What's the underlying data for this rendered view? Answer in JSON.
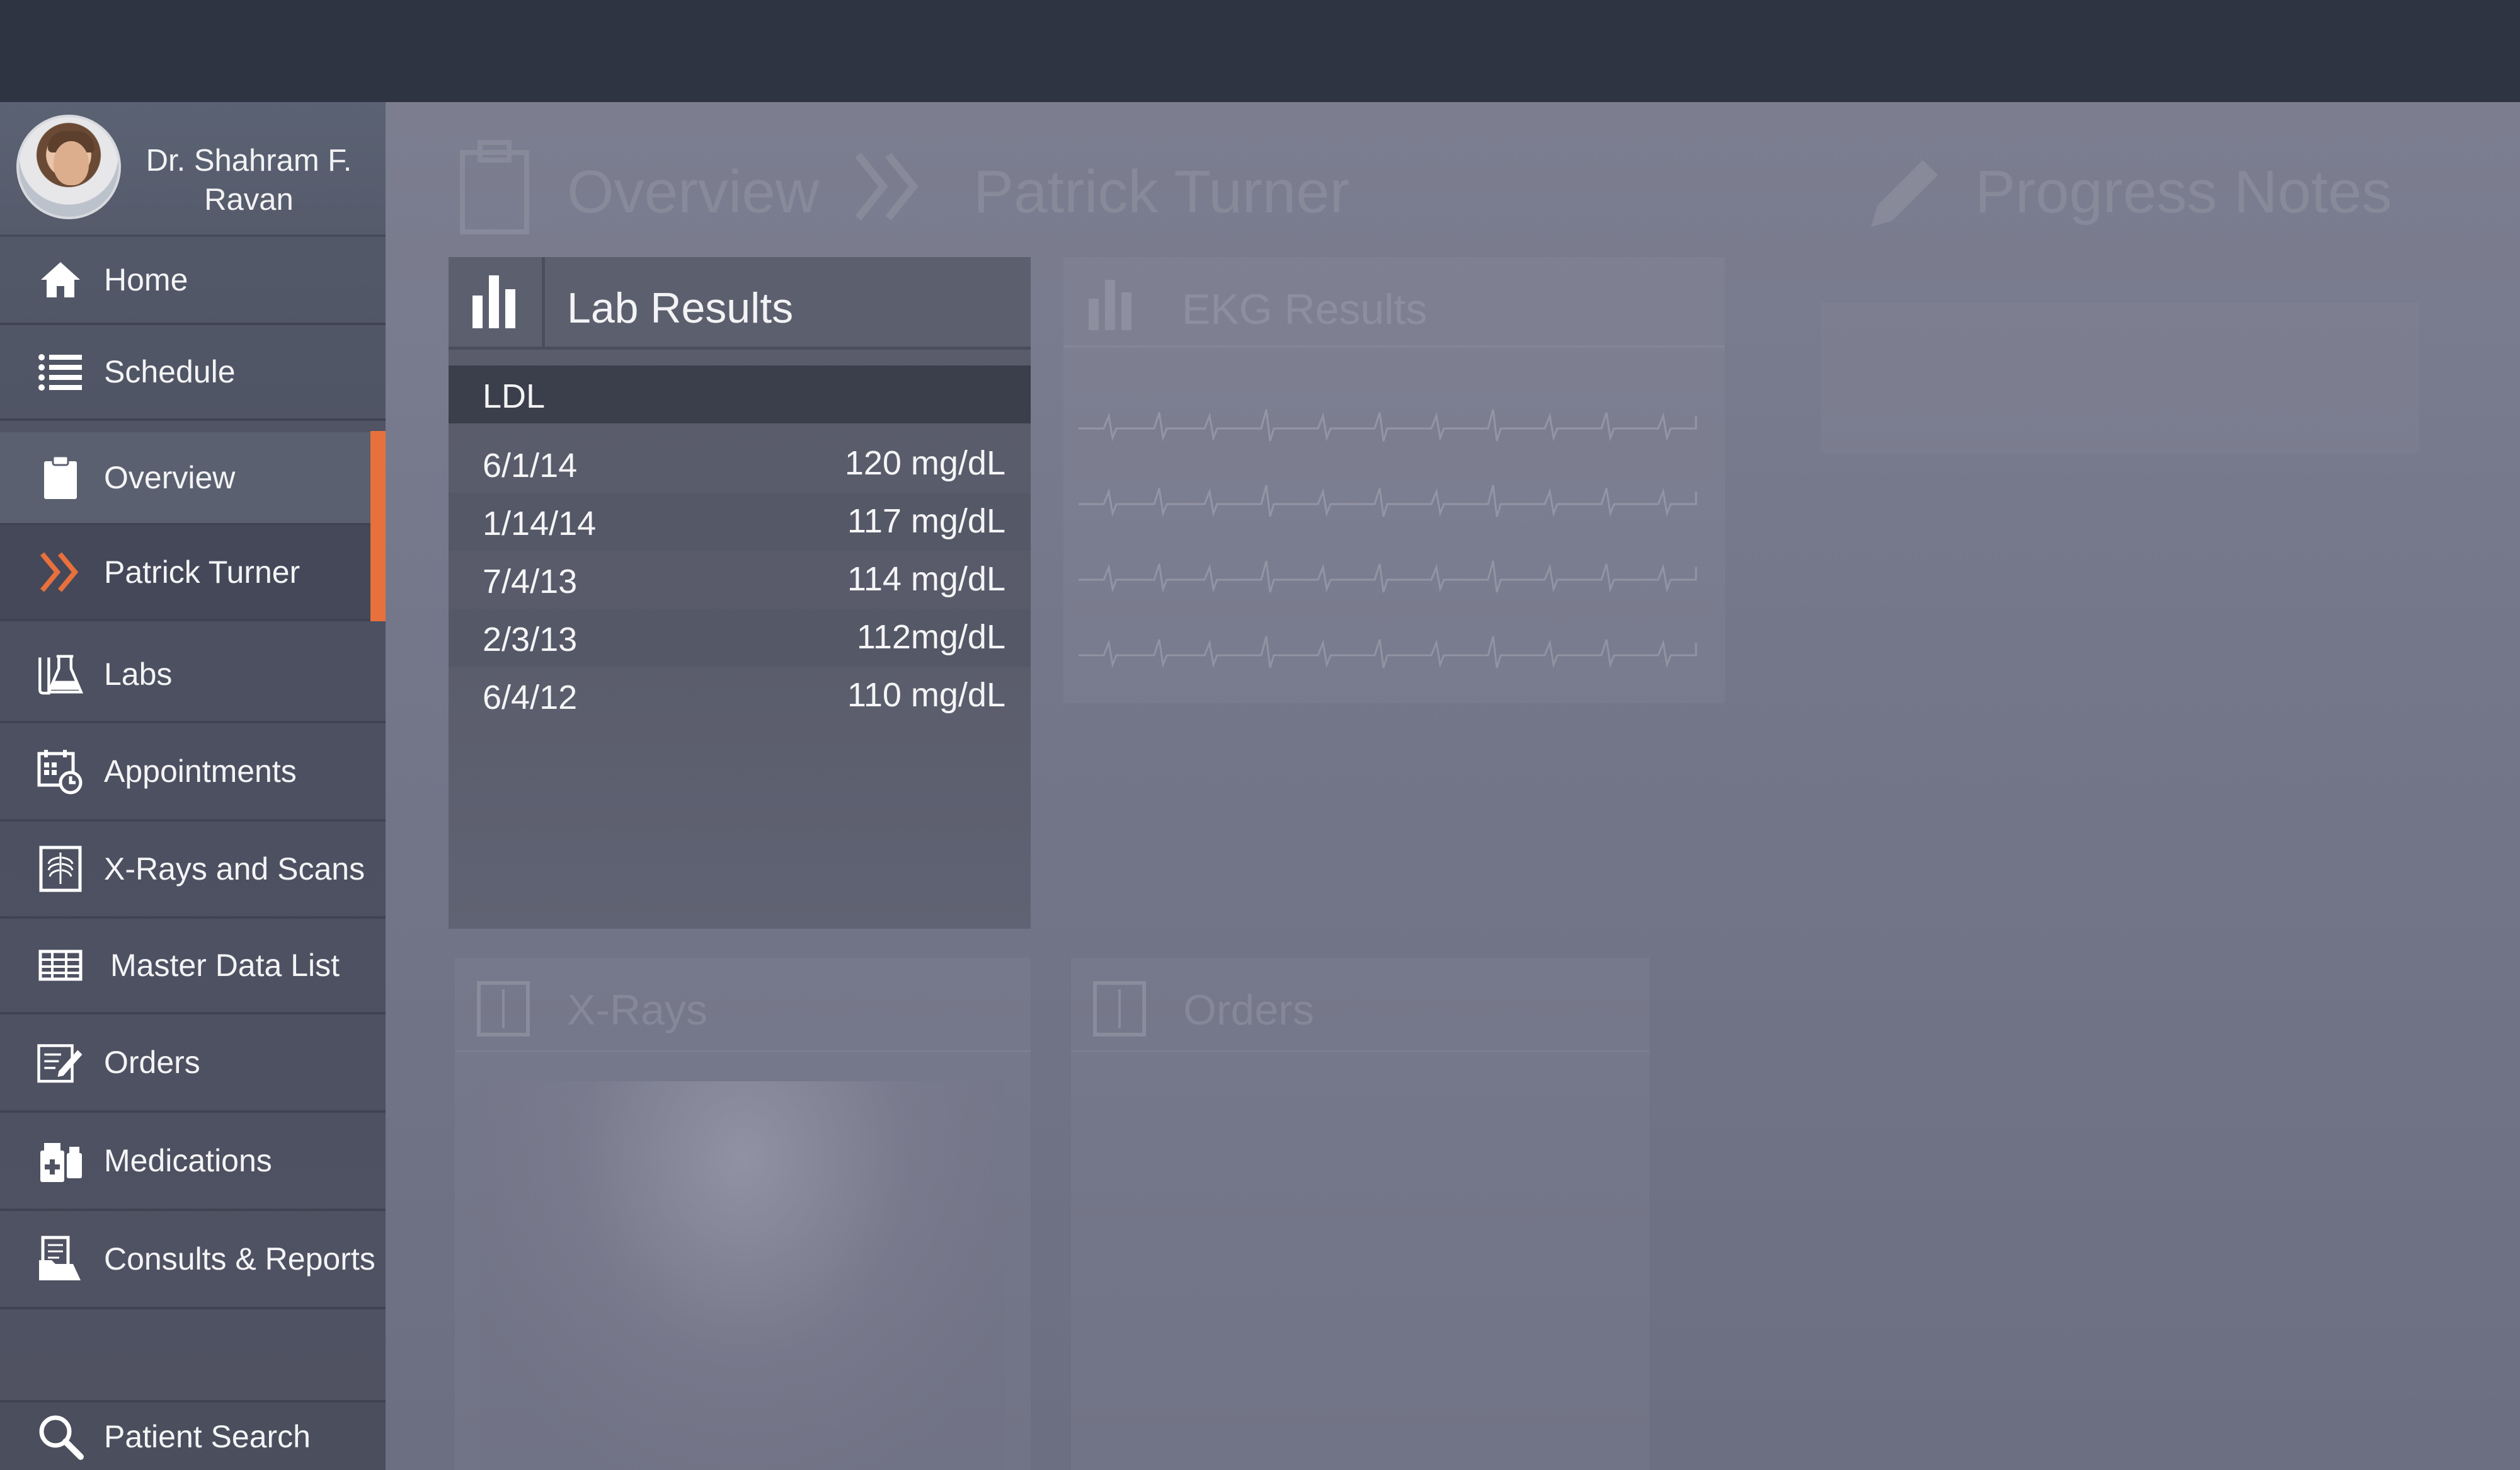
{
  "doctor": {
    "name_line1": "Dr. Shahram F.",
    "name_line2": "Ravan"
  },
  "nav": [
    {
      "label": "Home",
      "icon": "home-icon"
    },
    {
      "label": "Schedule",
      "icon": "list-icon"
    },
    {
      "label": "Overview",
      "icon": "clipboard-icon"
    },
    {
      "label": "Patrick Turner",
      "icon": "double-chevron-right-icon"
    },
    {
      "label": "Labs",
      "icon": "flask-icon"
    },
    {
      "label": "Appointments",
      "icon": "calendar-clock-icon"
    },
    {
      "label": "X-Rays and Scans",
      "icon": "xray-icon"
    },
    {
      "label": "Master Data List",
      "icon": "table-icon"
    },
    {
      "label": "Orders",
      "icon": "edit-document-icon"
    },
    {
      "label": "Medications",
      "icon": "medication-icon"
    },
    {
      "label": "Consults & Reports",
      "icon": "folder-document-icon"
    },
    {
      "label": "Patient Search",
      "icon": "search-icon"
    }
  ],
  "breadcrumb": {
    "overview": "Overview",
    "patient": "Patrick Turner",
    "progress": "Progress Notes"
  },
  "lab_results": {
    "title": "Lab Results",
    "test": "LDL",
    "rows": [
      {
        "date": "6/1/14",
        "value": "120 mg/dL"
      },
      {
        "date": "1/14/14",
        "value": "117 mg/dL"
      },
      {
        "date": "7/4/13",
        "value": "114 mg/dL"
      },
      {
        "date": "2/3/13",
        "value": "112mg/dL"
      },
      {
        "date": "6/4/12",
        "value": "110 mg/dL"
      }
    ]
  },
  "cards": {
    "ekg": "EKG Results",
    "xrays": "X-Rays",
    "orders": "Orders"
  },
  "colors": {
    "accent": "#e8703c",
    "topbar": "#2e3442"
  }
}
